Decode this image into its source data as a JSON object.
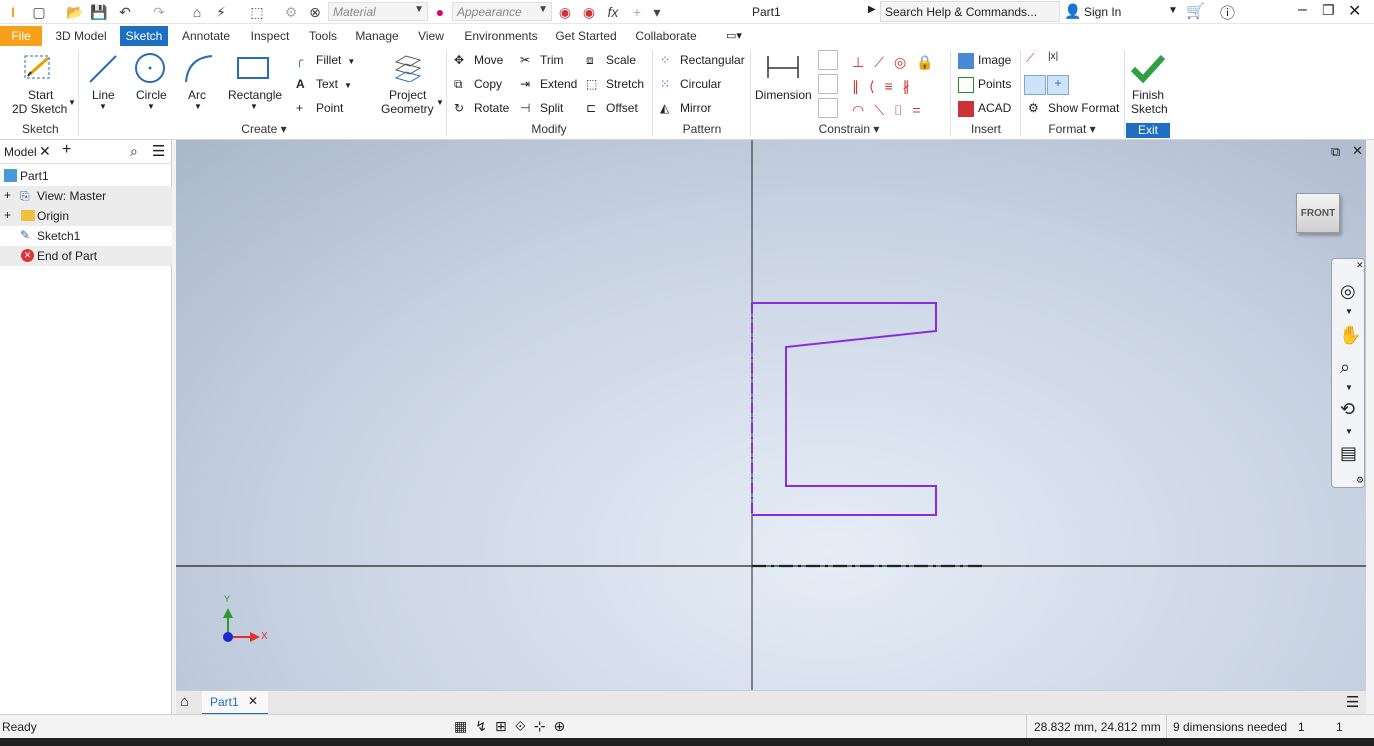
{
  "app": {
    "document_title": "Part1",
    "search_placeholder": "Search Help & Commands...",
    "sign_in": "Sign In",
    "material_placeholder": "Material",
    "appearance_placeholder": "Appearance"
  },
  "menu_tabs": [
    "File",
    "3D Model",
    "Sketch",
    "Annotate",
    "Inspect",
    "Tools",
    "Manage",
    "View",
    "Environments",
    "Get Started",
    "Collaborate"
  ],
  "ribbon": {
    "sketch_group": {
      "start_label_1": "Start",
      "start_label_2": "2D Sketch",
      "panel": "Sketch"
    },
    "create_group": {
      "line": "Line",
      "circle": "Circle",
      "arc": "Arc",
      "rectangle": "Rectangle",
      "fillet": "Fillet",
      "text": "Text",
      "point": "Point",
      "project_1": "Project",
      "project_2": "Geometry",
      "panel": "Create"
    },
    "modify_group": {
      "move": "Move",
      "copy": "Copy",
      "rotate": "Rotate",
      "trim": "Trim",
      "extend": "Extend",
      "split": "Split",
      "scale": "Scale",
      "stretch": "Stretch",
      "offset": "Offset",
      "panel": "Modify"
    },
    "pattern_group": {
      "rectangular": "Rectangular",
      "circular": "Circular",
      "mirror": "Mirror",
      "panel": "Pattern"
    },
    "constrain_group": {
      "dimension": "Dimension",
      "panel": "Constrain"
    },
    "insert_group": {
      "image": "Image",
      "points": "Points",
      "acad": "ACAD",
      "panel": "Insert"
    },
    "format_group": {
      "show_format": "Show Format",
      "panel": "Format"
    },
    "exit_group": {
      "finish_1": "Finish",
      "finish_2": "Sketch",
      "panel": "Exit"
    }
  },
  "browser": {
    "tab_label": "Model",
    "items": [
      {
        "label": "Part1"
      },
      {
        "label": "View: Master"
      },
      {
        "label": "Origin"
      },
      {
        "label": "Sketch1"
      },
      {
        "label": "End of Part"
      }
    ]
  },
  "viewcube": {
    "face": "FRONT"
  },
  "triad": {
    "x": "X",
    "y": "Y"
  },
  "doc_tab": {
    "label": "Part1"
  },
  "status": {
    "left": "Ready",
    "coords": "28.832 mm, 24.812 mm",
    "dims": "9 dimensions needed",
    "n1": "1",
    "n2": "1"
  },
  "colors": {
    "accent": "#1e6fc2",
    "file_tab": "#f7a11a",
    "sketch_line": "#8a2be2",
    "finish_check": "#2ea043"
  }
}
